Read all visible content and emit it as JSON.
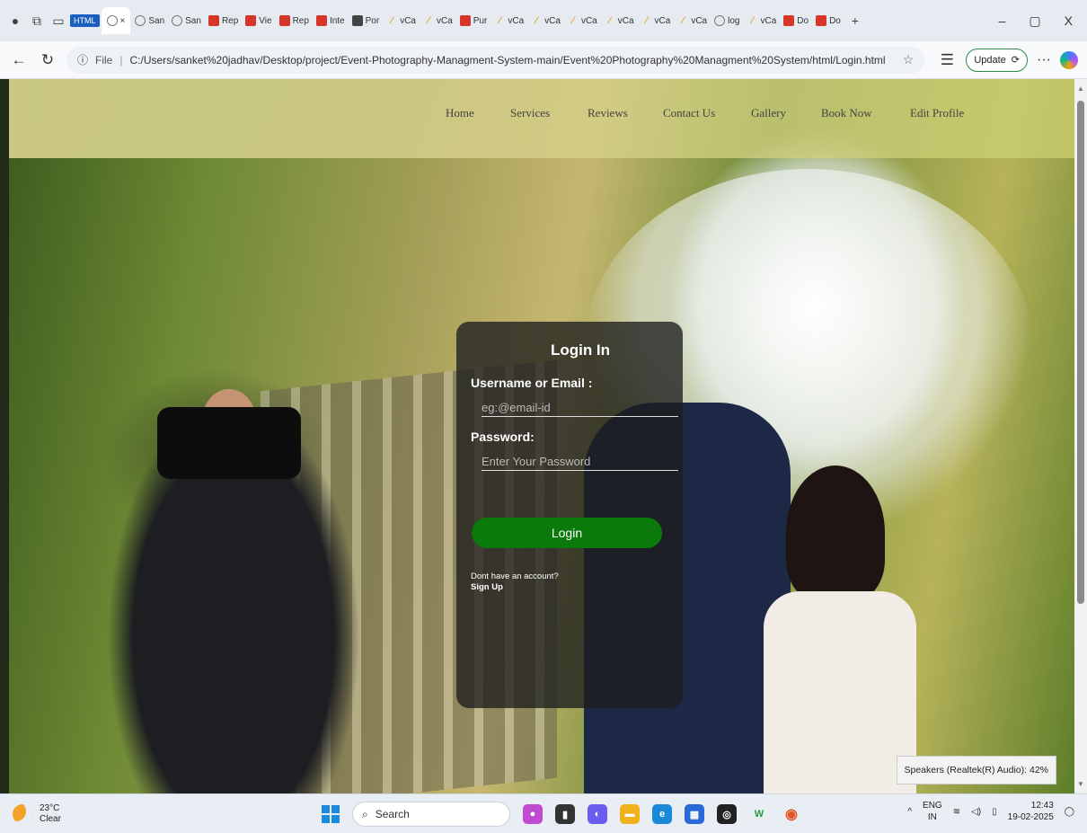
{
  "browser": {
    "tabs": [
      {
        "label": "HTML",
        "kind": "badge"
      },
      {
        "label": "×",
        "kind": "active"
      },
      {
        "label": "San",
        "kind": "globe"
      },
      {
        "label": "San",
        "kind": "globe"
      },
      {
        "label": "Rep",
        "kind": "pdf"
      },
      {
        "label": "Vie",
        "kind": "pdf"
      },
      {
        "label": "Rep",
        "kind": "pdf"
      },
      {
        "label": "Inte",
        "kind": "pdf"
      },
      {
        "label": "Por",
        "kind": "img"
      },
      {
        "label": "vCa",
        "kind": "v"
      },
      {
        "label": "vCa",
        "kind": "v"
      },
      {
        "label": "Pur",
        "kind": "pdf"
      },
      {
        "label": "vCa",
        "kind": "v"
      },
      {
        "label": "vCa",
        "kind": "v"
      },
      {
        "label": "vCa",
        "kind": "v"
      },
      {
        "label": "vCa",
        "kind": "v"
      },
      {
        "label": "vCa",
        "kind": "v"
      },
      {
        "label": "vCa",
        "kind": "v"
      },
      {
        "label": "log",
        "kind": "globe"
      },
      {
        "label": "vCa",
        "kind": "v"
      },
      {
        "label": "Do",
        "kind": "pdf"
      },
      {
        "label": "Do",
        "kind": "pdf"
      }
    ],
    "new_tab": "+",
    "window_controls": {
      "minimize": "–",
      "restore": "▢",
      "close": "X"
    },
    "address": {
      "info_label": "File",
      "url": "C:/Users/sanket%20jadhav/Desktop/project/Event-Photography-Managment-System-main/Event%20Photography%20Managment%20System/html/Login.html"
    },
    "update_label": "Update",
    "more_label": "···"
  },
  "site": {
    "nav": [
      "Home",
      "Services",
      "Reviews",
      "Contact Us",
      "Gallery",
      "Book Now",
      "Edit Profile"
    ],
    "login": {
      "title": "Login In",
      "username_label": "Username or Email :",
      "username_placeholder": "eg:@email-id",
      "password_label": "Password:",
      "password_placeholder": "Enter Your Password",
      "button": "Login",
      "no_account": "Dont have an account?",
      "signup": "Sign Up"
    }
  },
  "toast": "Speakers (Realtek(R) Audio): 42%",
  "taskbar": {
    "temp": "23°C",
    "condition": "Clear",
    "search_placeholder": "Search",
    "lang": "ENG",
    "region": "IN",
    "time": "12:43",
    "date": "19-02-2025"
  },
  "colors": {
    "login_button": "#0a7a0a",
    "card_bg": "rgba(30,30,30,0.78)",
    "header_tint": "#d8d28e"
  }
}
